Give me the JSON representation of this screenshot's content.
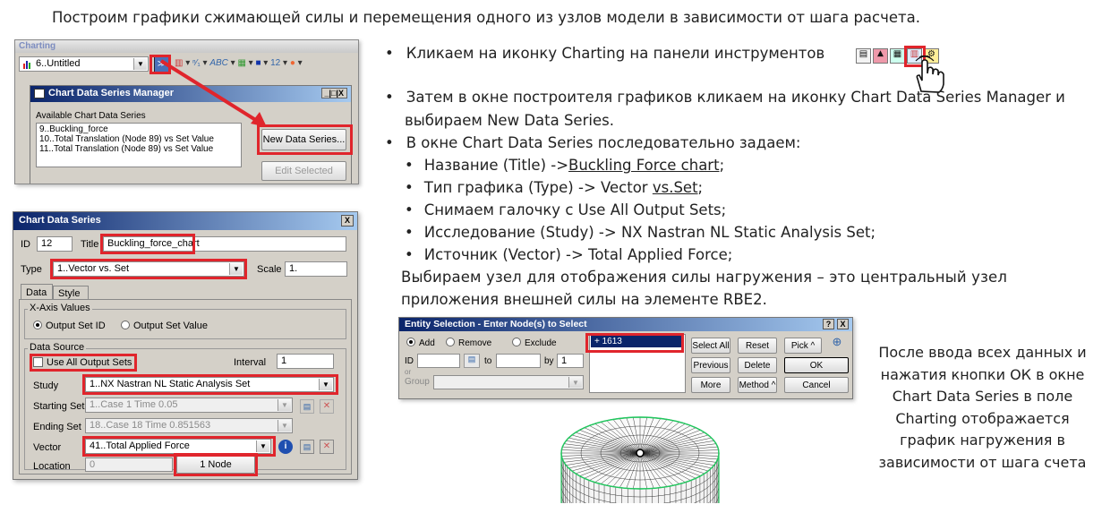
{
  "heading": "Построим графики сжимающей силы и перемещения одного из узлов модели в зависимости от шага расчета.",
  "charting": {
    "title": "Charting",
    "chart_select": "6..Untitled",
    "mgr_title": "Chart Data Series Manager",
    "available_label": "Available Chart Data Series",
    "series": [
      "9..Buckling_force",
      "10..Total Translation (Node 89) vs Set Value",
      "11..Total Translation (Node 89) vs Set Value"
    ],
    "new_series_btn": "New Data Series...",
    "edit_btn": "Edit Selected",
    "win_controls": "_|□|X"
  },
  "cds": {
    "title": "Chart Data Series",
    "close": "X",
    "id_label": "ID",
    "id_value": "12",
    "title_label": "Title",
    "title_value": "Buckling_force_chart",
    "type_label": "Type",
    "type_value": "1..Vector vs. Set",
    "scale_label": "Scale",
    "scale_value": "1.",
    "tab_data": "Data",
    "tab_style": "Style",
    "xaxis_group": "X-Axis Values",
    "opt_output_set_id": "Output Set ID",
    "opt_output_set_value": "Output Set Value",
    "source_group": "Data Source",
    "use_all": "Use All Output Sets",
    "interval_label": "Interval",
    "interval_value": "1",
    "study_label": "Study",
    "study_value": "1..NX Nastran NL Static Analysis Set",
    "starting_label": "Starting Set",
    "starting_value": "1..Case 1 Time 0.05",
    "ending_label": "Ending Set",
    "ending_value": "18..Case 18 Time 0.851563",
    "vector_label": "Vector",
    "vector_value": "41..Total Applied Force",
    "location_label": "Location",
    "location_value": "0",
    "node_btn": "1 Node"
  },
  "entity": {
    "title": "Entity Selection - Enter Node(s) to Select",
    "help": "?",
    "close": "X",
    "add": "Add",
    "remove": "Remove",
    "exclude": "Exclude",
    "id_label": "ID",
    "or_label": "or",
    "group_label": "Group",
    "to_label": "to",
    "by_label": "by",
    "by_value": "1",
    "list_item": "+ 1613",
    "select_all": "Select All",
    "reset": "Reset",
    "pick": "Pick ^",
    "previous": "Previous",
    "delete": "Delete",
    "ok": "OK",
    "more": "More",
    "method": "Method ^",
    "cancel": "Cancel"
  },
  "instructions": {
    "b1": "Кликаем на иконку  Charting на панели инструментов",
    "b2_l1": "Затем в окне построителя графиков кликаем на иконку Chart Data Series Manager и",
    "b2_l2": "выбираем New Data Series.",
    "b3": "В окне Chart Data Series последовательно задаем:",
    "s1_a": "Название (Title) ->",
    "s1_b": "Buckling Force chart",
    "s1_c": ";",
    "s2_a": "Тип графика (Type) -> Vector ",
    "s2_b": "vs.Set",
    "s2_c": ";",
    "s3": "Снимаем галочку с Use All Output Sets;",
    "s4": "Исследование (Study) -> NX Nastran NL Static Analysis Set;",
    "s5": "Источник (Vector) -> Total Applied Force;",
    "p_l1": "Выбираем  узел  для  отображения  силы  нагружения  –  это  центральный  узел",
    "p_l2": "приложения внешней силы на элементе RBE2.",
    "side_l1": "После ввода всех данных и",
    "side_l2": "нажатия кнопки ОК в окне",
    "side_l3": "Chart Data Series в поле",
    "side_l4": "Charting отображается",
    "side_l5": "график нагружения в",
    "side_l6": "зависимости от шага счета"
  },
  "colors": {
    "highlight": "#e0252c",
    "titlebar": "#0a246a",
    "mesh": "#22c55e"
  }
}
